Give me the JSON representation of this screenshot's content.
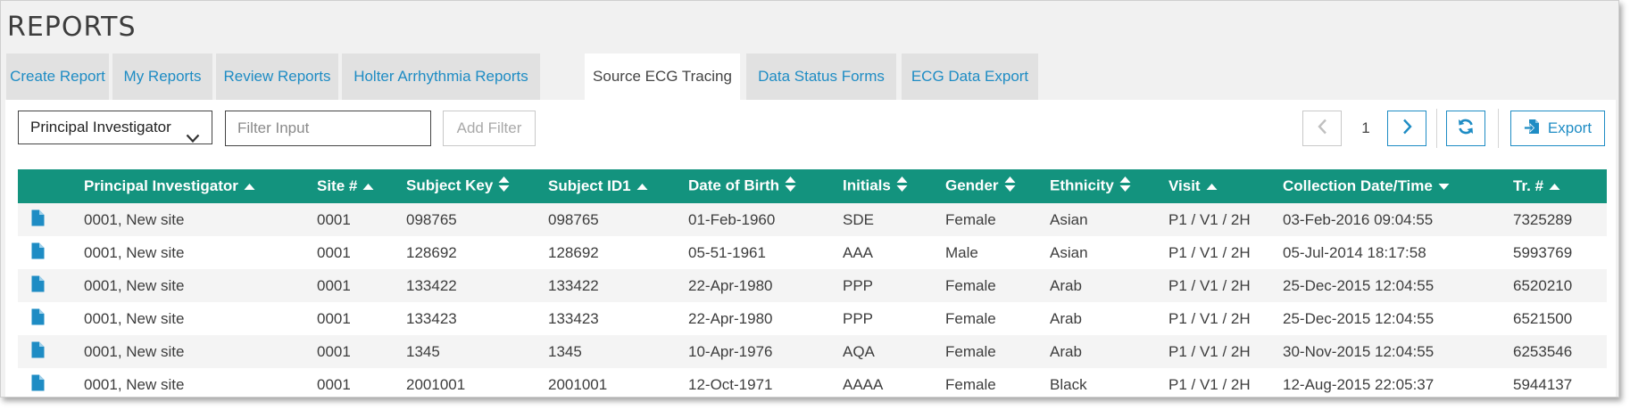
{
  "page": {
    "title": "REPORTS"
  },
  "tabs": [
    {
      "label": "Create Report",
      "active": false
    },
    {
      "label": "My Reports",
      "active": false
    },
    {
      "label": "Review Reports",
      "active": false
    },
    {
      "label": "Holter Arrhythmia Reports",
      "active": false
    },
    {
      "label": "Source ECG Tracing",
      "active": true
    },
    {
      "label": "Data Status Forms",
      "active": false
    },
    {
      "label": "ECG Data Export",
      "active": false
    }
  ],
  "toolbar": {
    "filter_field": "Principal Investigator",
    "filter_placeholder": "Filter Input",
    "add_filter_label": "Add Filter",
    "page_number": "1",
    "export_label": "Export"
  },
  "colors": {
    "accent": "#1e8cc4",
    "header_bg": "#13937e"
  },
  "table": {
    "columns": [
      {
        "label": "",
        "sort": "none"
      },
      {
        "label": "Principal Investigator",
        "sort": "asc"
      },
      {
        "label": "Site #",
        "sort": "asc"
      },
      {
        "label": "Subject Key",
        "sort": "both"
      },
      {
        "label": "Subject ID1",
        "sort": "asc"
      },
      {
        "label": "Date of Birth",
        "sort": "both"
      },
      {
        "label": "Initials",
        "sort": "both"
      },
      {
        "label": "Gender",
        "sort": "both"
      },
      {
        "label": "Ethnicity",
        "sort": "both"
      },
      {
        "label": "Visit",
        "sort": "asc"
      },
      {
        "label": "Collection Date/Time",
        "sort": "desc"
      },
      {
        "label": "Tr. #",
        "sort": "asc"
      }
    ],
    "row_icon": "document-icon",
    "rows": [
      [
        "0001, New site",
        "0001",
        "098765",
        "098765",
        "01-Feb-1960",
        "SDE",
        "Female",
        "Asian",
        "P1 / V1 / 2H",
        "03-Feb-2016 09:04:55",
        "7325289"
      ],
      [
        "0001, New site",
        "0001",
        "128692",
        "128692",
        "05-51-1961",
        "AAA",
        "Male",
        "Asian",
        "P1 / V1 / 2H",
        "05-Jul-2014 18:17:58",
        "5993769"
      ],
      [
        "0001, New site",
        "0001",
        "133422",
        "133422",
        "22-Apr-1980",
        "PPP",
        "Female",
        "Arab",
        "P1 / V1 / 2H",
        "25-Dec-2015 12:04:55",
        "6520210"
      ],
      [
        "0001, New site",
        "0001",
        "133423",
        "133423",
        "22-Apr-1980",
        "PPP",
        "Female",
        "Arab",
        "P1 / V1 / 2H",
        "25-Dec-2015 12:04:55",
        "6521500"
      ],
      [
        "0001, New site",
        "0001",
        "1345",
        "1345",
        "10-Apr-1976",
        "AQA",
        "Female",
        "Arab",
        "P1 / V1 / 2H",
        "30-Nov-2015 12:04:55",
        "6253546"
      ],
      [
        "0001, New site",
        "0001",
        "2001001",
        "2001001",
        "12-Oct-1971",
        "AAAA",
        "Female",
        "Black",
        "P1 / V1 / 2H",
        "12-Aug-2015 22:05:37",
        "5944137"
      ]
    ]
  }
}
